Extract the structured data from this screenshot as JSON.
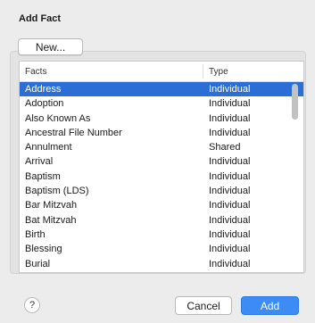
{
  "dialog": {
    "title": "Add Fact",
    "new_label": "New...",
    "help_label": "?",
    "cancel_label": "Cancel",
    "add_label": "Add"
  },
  "table": {
    "headers": {
      "facts": "Facts",
      "type": "Type"
    },
    "rows": [
      {
        "name": "Address",
        "type": "Individual",
        "selected": true
      },
      {
        "name": "Adoption",
        "type": "Individual"
      },
      {
        "name": "Also Known As",
        "type": "Individual"
      },
      {
        "name": "Ancestral File Number",
        "type": "Individual"
      },
      {
        "name": "Annulment",
        "type": "Shared"
      },
      {
        "name": "Arrival",
        "type": "Individual"
      },
      {
        "name": "Baptism",
        "type": "Individual"
      },
      {
        "name": "Baptism (LDS)",
        "type": "Individual"
      },
      {
        "name": "Bar Mitzvah",
        "type": "Individual"
      },
      {
        "name": "Bat Mitzvah",
        "type": "Individual"
      },
      {
        "name": "Birth",
        "type": "Individual"
      },
      {
        "name": "Blessing",
        "type": "Individual"
      },
      {
        "name": "Burial",
        "type": "Individual"
      }
    ]
  },
  "colors": {
    "selection": "#2b6fd6",
    "accent_button": "#3d8cf5",
    "dialog_background": "#ececec"
  }
}
